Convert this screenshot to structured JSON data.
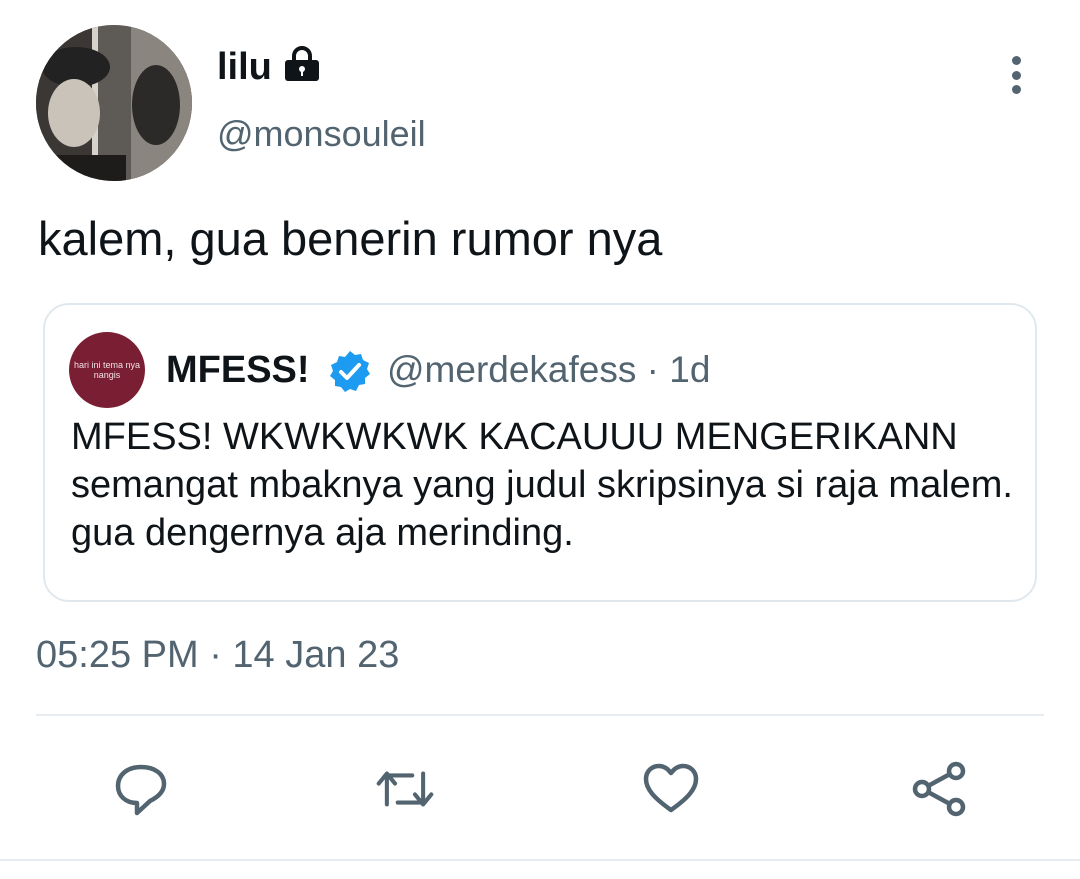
{
  "tweet": {
    "author": {
      "display_name": "lilu",
      "handle": "@monsouleil",
      "protected_icon": "lock-icon"
    },
    "text": "kalem, gua benerin rumor nya",
    "timestamp": "05:25 PM · 14 Jan 23"
  },
  "quoted_tweet": {
    "avatar_text": "hari ini tema nya nangis",
    "display_name": "MFESS!",
    "verified_icon": "verified-badge-icon",
    "handle": "@merdekafess",
    "meta": "@merdekafess · 1d",
    "text": "MFESS! WKWKWKWK KACAUUU MENGERIKANN semangat mbaknya yang judul skripsinya si raja malem. gua dengernya aja merinding."
  },
  "actions": {
    "reply_icon": "reply-icon",
    "retweet_icon": "retweet-icon",
    "like_icon": "heart-icon",
    "share_icon": "share-icon",
    "more_icon": "more-vertical-icon"
  },
  "colors": {
    "secondary_text": "#536471",
    "verified_blue": "#1d9bf0",
    "quote_avatar_bg": "#7a1f33",
    "border": "#e1e8ed"
  }
}
